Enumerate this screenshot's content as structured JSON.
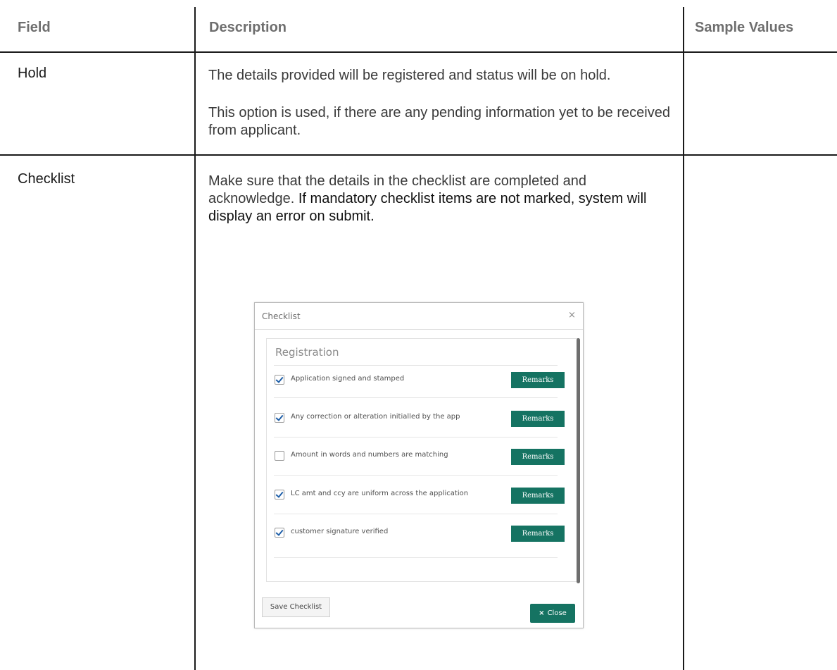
{
  "table": {
    "headers": {
      "field": "Field",
      "description": "Description",
      "sample_values": "Sample Values"
    },
    "rows": [
      {
        "field": "Hold",
        "description": [
          "The details provided will be registered and status will be on hold.",
          "This option is used, if there are any pending information yet to be received from applicant."
        ],
        "sample_values": ""
      },
      {
        "field": "Checklist",
        "description_part1": "Make sure that the details in the checklist are completed and acknowledge.",
        "description_part2": "If mandatory checklist items are not marked, system will display an error on submit.",
        "sample_values": ""
      }
    ]
  },
  "checklist_dialog": {
    "title": "Checklist",
    "close_x": "×",
    "section_title": "Registration",
    "items": [
      {
        "label": "Application signed and stamped",
        "checked": true,
        "button": "Remarks"
      },
      {
        "label": "Any correction or alteration initialled by the  app",
        "checked": true,
        "button": "Remarks"
      },
      {
        "label": "Amount in words and numbers are matching",
        "checked": false,
        "button": "Remarks"
      },
      {
        "label": "LC amt and ccy are uniform across the application",
        "checked": true,
        "button": "Remarks"
      },
      {
        "label": "customer signature verified",
        "checked": true,
        "button": "Remarks"
      }
    ],
    "save_button": "Save Checklist",
    "close_icon": "×",
    "close_button": "Close"
  }
}
